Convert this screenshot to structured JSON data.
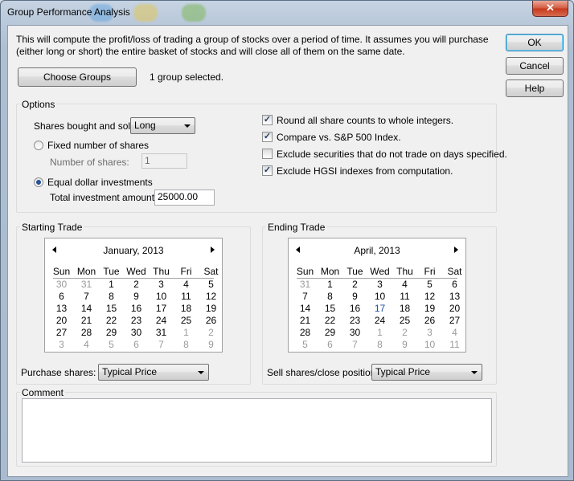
{
  "window": {
    "title": "Group Performance Analysis",
    "close_glyph": "✕"
  },
  "description": "This will compute the profit/loss of trading a group of stocks over a period of time.  It assumes you will purchase (either long or short) the entire basket of stocks and will close all of them on the same date.",
  "buttons": {
    "ok": "OK",
    "cancel": "Cancel",
    "help": "Help",
    "choose_groups": "Choose Groups"
  },
  "groups_status": "1 group selected.",
  "options": {
    "label": "Options",
    "shares_label": "Shares bought and sold:",
    "shares_value": "Long",
    "fixed_label": "Fixed number of shares",
    "fixed_checked": false,
    "num_shares_label": "Number of shares:",
    "num_shares_value": "1",
    "equal_label": "Equal dollar investments",
    "equal_checked": true,
    "total_label": "Total investment amount:",
    "total_value": "25000.00",
    "checks": [
      {
        "label": "Round all share counts to whole integers.",
        "checked": true
      },
      {
        "label": "Compare vs. S&P 500 Index.",
        "checked": true
      },
      {
        "label": "Exclude securities that do not trade on days specified.",
        "checked": false
      },
      {
        "label": "Exclude HGSI indexes from computation.",
        "checked": true
      }
    ]
  },
  "starting": {
    "label": "Starting Trade",
    "month": "January, 2013",
    "purchase_label": "Purchase shares:",
    "purchase_value": "Typical Price",
    "weeks": [
      [
        "30",
        "31",
        "1",
        "2",
        "3",
        "4",
        "5"
      ],
      [
        "6",
        "7",
        "8",
        "9",
        "10",
        "11",
        "12"
      ],
      [
        "13",
        "14",
        "15",
        "16",
        "17",
        "18",
        "19"
      ],
      [
        "20",
        "21",
        "22",
        "23",
        "24",
        "25",
        "26"
      ],
      [
        "27",
        "28",
        "29",
        "30",
        "31",
        "1",
        "2"
      ],
      [
        "3",
        "4",
        "5",
        "6",
        "7",
        "8",
        "9"
      ]
    ]
  },
  "ending": {
    "label": "Ending Trade",
    "month": "April, 2013",
    "sell_label": "Sell shares/close position:",
    "sell_value": "Typical Price",
    "weeks": [
      [
        "31",
        "1",
        "2",
        "3",
        "4",
        "5",
        "6"
      ],
      [
        "7",
        "8",
        "9",
        "10",
        "11",
        "12",
        "13"
      ],
      [
        "14",
        "15",
        "16",
        "17",
        "18",
        "19",
        "20"
      ],
      [
        "21",
        "22",
        "23",
        "24",
        "25",
        "26",
        "27"
      ],
      [
        "28",
        "29",
        "30",
        "1",
        "2",
        "3",
        "4"
      ],
      [
        "5",
        "6",
        "7",
        "8",
        "9",
        "10",
        "11"
      ]
    ]
  },
  "weekdays": [
    "Sun",
    "Mon",
    "Tue",
    "Wed",
    "Thu",
    "Fri",
    "Sat"
  ],
  "comment": {
    "label": "Comment",
    "value": ""
  },
  "check_glyph": "✓"
}
